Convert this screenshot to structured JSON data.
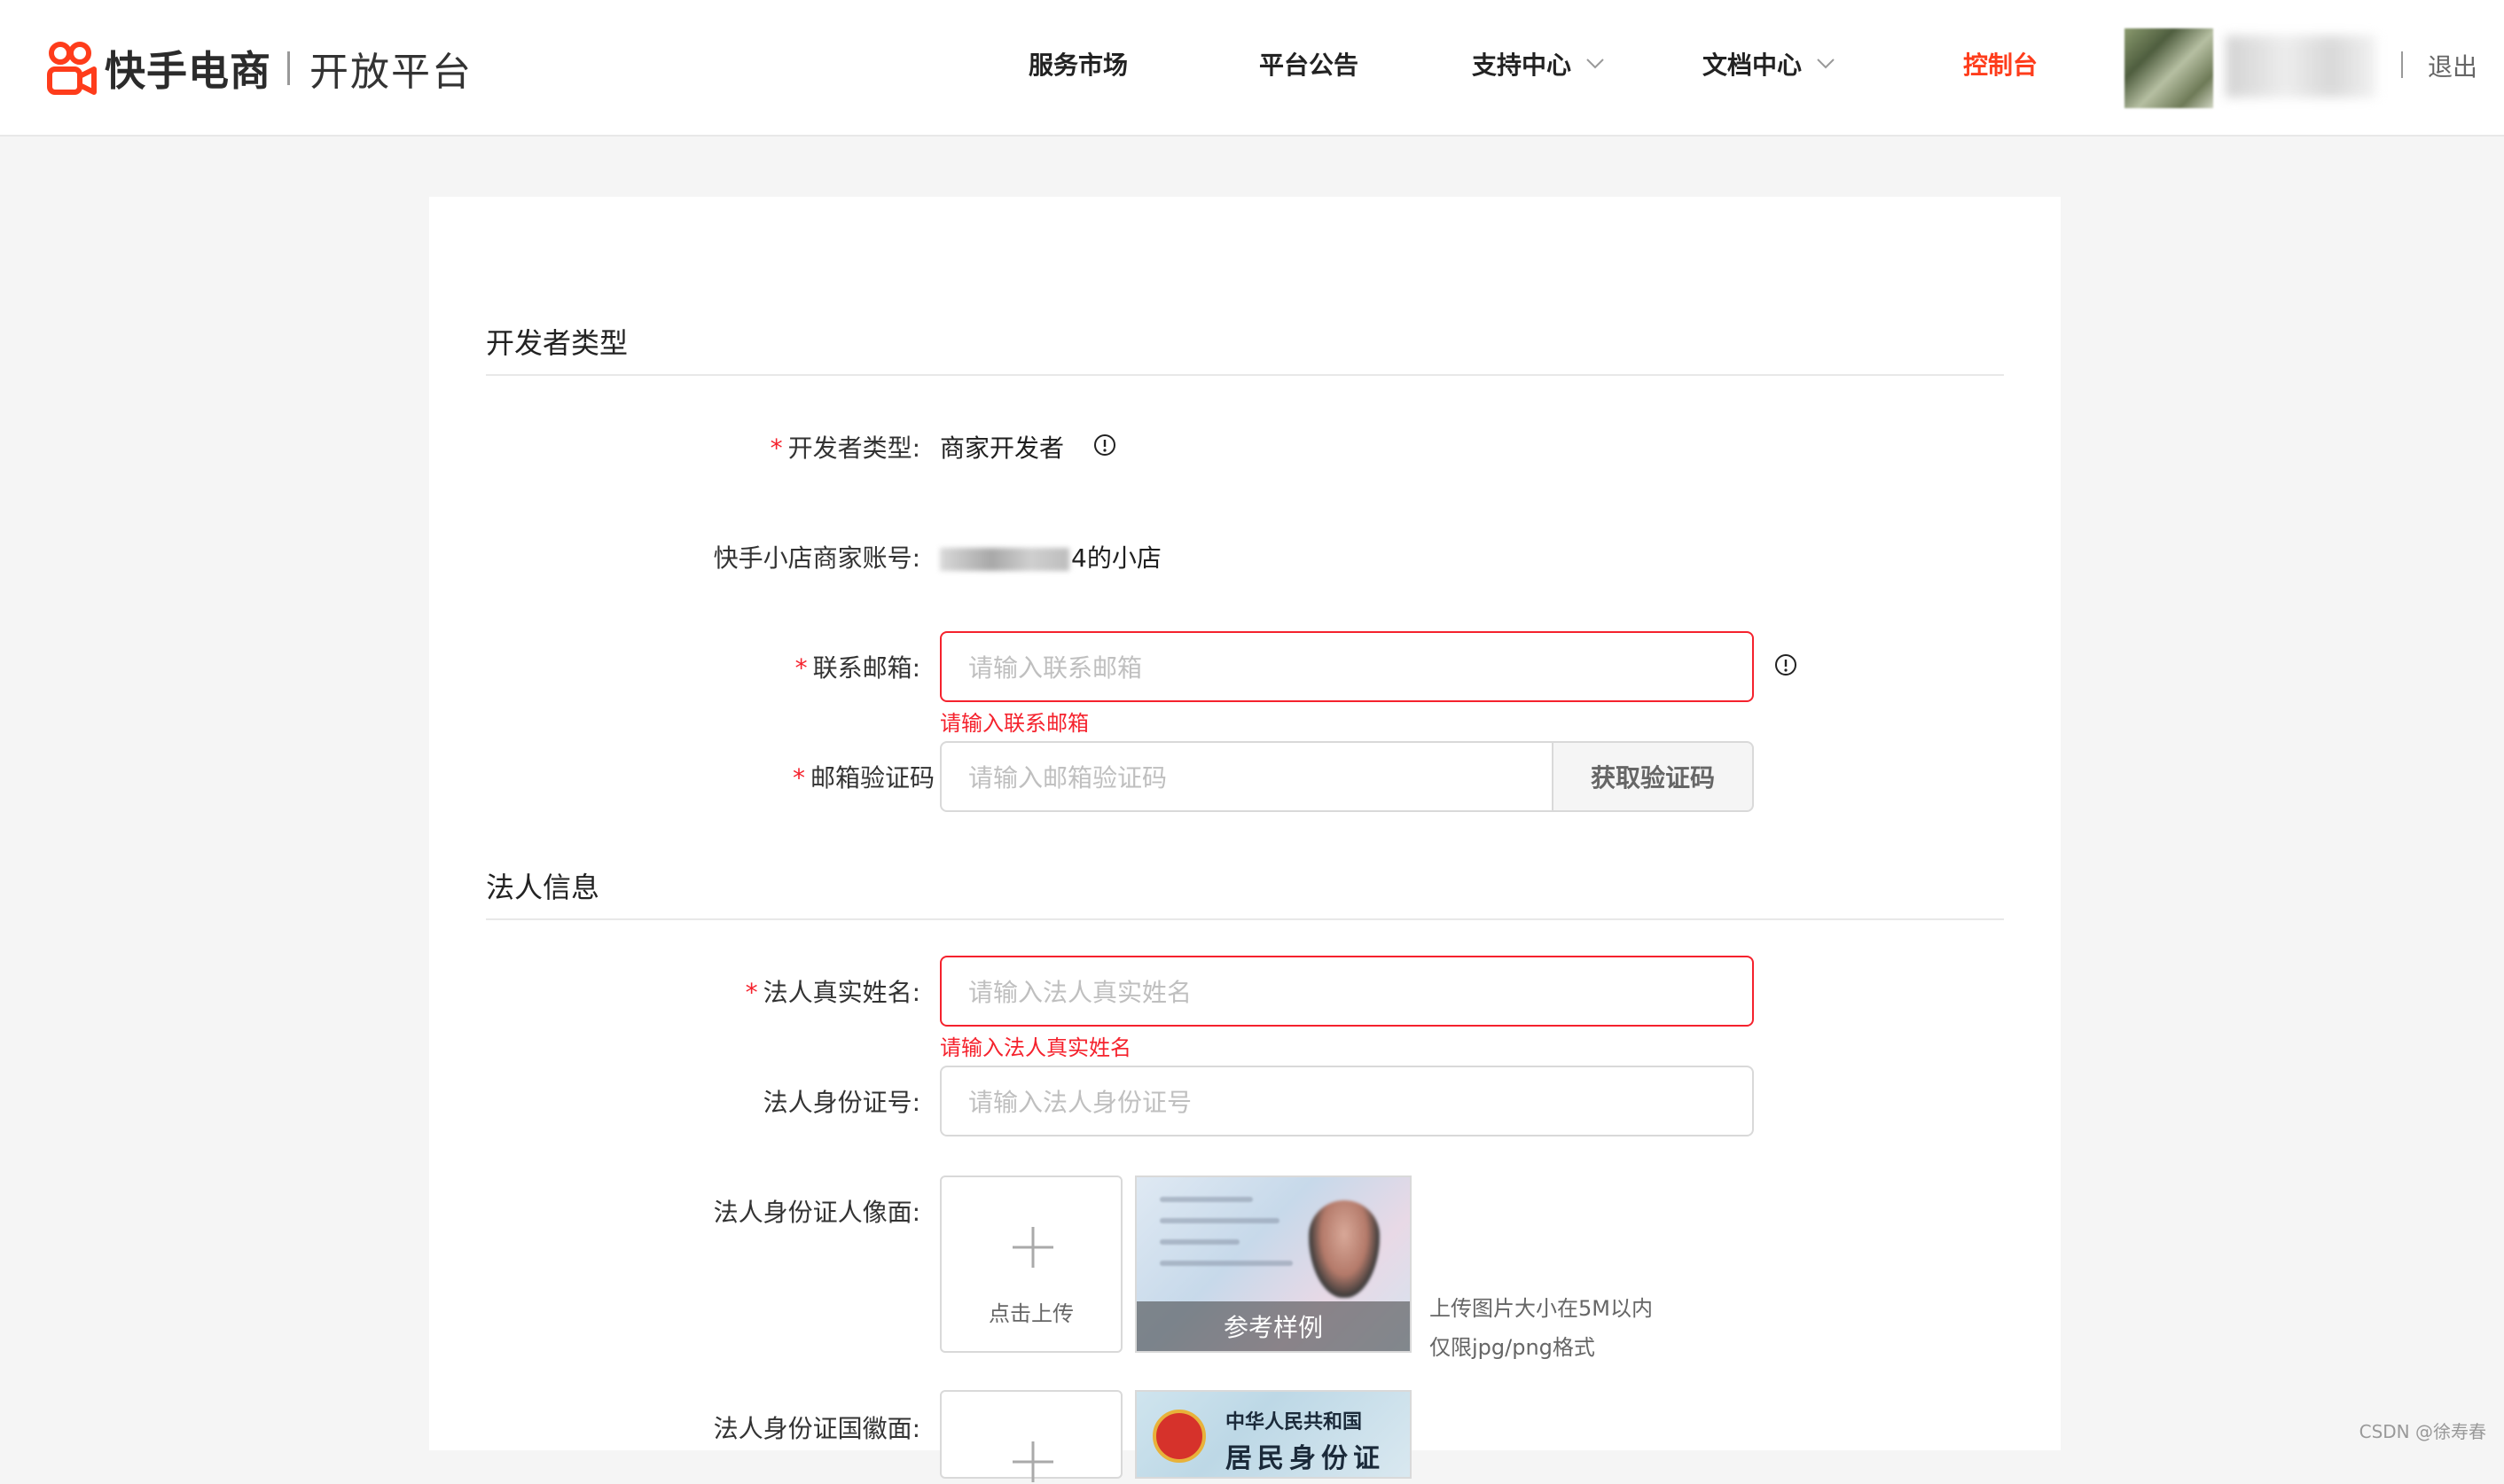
{
  "header": {
    "brand": "快手电商",
    "sub_brand": "开放平台",
    "nav": [
      {
        "label": "服务市场"
      },
      {
        "label": "平台公告"
      },
      {
        "label": "支持中心"
      },
      {
        "label": "文档中心"
      },
      {
        "label": "控制台"
      }
    ],
    "logout": "退出"
  },
  "colors": {
    "accent": "#fe3c1b",
    "error": "#f5222d"
  },
  "sections": {
    "developer": {
      "title": "开发者类型",
      "type_label": "开发者类型:",
      "type_value": "商家开发者",
      "account_label": "快手小店商家账号:",
      "account_suffix": "4的小店",
      "email_label": "联系邮箱:",
      "email_placeholder": "请输入联系邮箱",
      "email_error": "请输入联系邮箱",
      "code_label": "邮箱验证码",
      "code_placeholder": "请输入邮箱验证码",
      "code_button": "获取验证码"
    },
    "legal": {
      "title": "法人信息",
      "name_label": "法人真实姓名:",
      "name_placeholder": "请输入法人真实姓名",
      "name_error": "请输入法人真实姓名",
      "id_label": "法人身份证号:",
      "id_placeholder": "请输入法人身份证号",
      "portrait_label": "法人身份证人像面:",
      "upload_text": "点击上传",
      "sample_label": "参考样例",
      "hint_size": "上传图片大小在5M以内",
      "hint_format": "仅限jpg/png格式",
      "emblem_label": "法人身份证国徽面:",
      "card_title": "中华人民共和国",
      "card_sub": "居民身份证"
    }
  },
  "watermark": "CSDN @徐寿春",
  "required_mark": "*"
}
